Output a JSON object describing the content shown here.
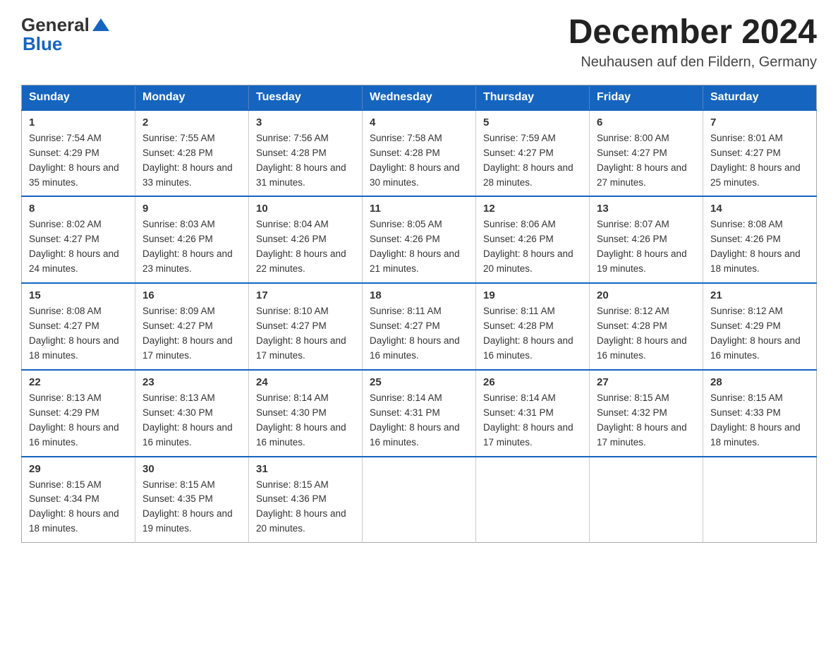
{
  "header": {
    "logo_general": "General",
    "logo_blue": "Blue",
    "month_title": "December 2024",
    "location": "Neuhausen auf den Fildern, Germany"
  },
  "columns": [
    "Sunday",
    "Monday",
    "Tuesday",
    "Wednesday",
    "Thursday",
    "Friday",
    "Saturday"
  ],
  "weeks": [
    [
      {
        "day": "1",
        "sunrise": "7:54 AM",
        "sunset": "4:29 PM",
        "daylight": "8 hours and 35 minutes."
      },
      {
        "day": "2",
        "sunrise": "7:55 AM",
        "sunset": "4:28 PM",
        "daylight": "8 hours and 33 minutes."
      },
      {
        "day": "3",
        "sunrise": "7:56 AM",
        "sunset": "4:28 PM",
        "daylight": "8 hours and 31 minutes."
      },
      {
        "day": "4",
        "sunrise": "7:58 AM",
        "sunset": "4:28 PM",
        "daylight": "8 hours and 30 minutes."
      },
      {
        "day": "5",
        "sunrise": "7:59 AM",
        "sunset": "4:27 PM",
        "daylight": "8 hours and 28 minutes."
      },
      {
        "day": "6",
        "sunrise": "8:00 AM",
        "sunset": "4:27 PM",
        "daylight": "8 hours and 27 minutes."
      },
      {
        "day": "7",
        "sunrise": "8:01 AM",
        "sunset": "4:27 PM",
        "daylight": "8 hours and 25 minutes."
      }
    ],
    [
      {
        "day": "8",
        "sunrise": "8:02 AM",
        "sunset": "4:27 PM",
        "daylight": "8 hours and 24 minutes."
      },
      {
        "day": "9",
        "sunrise": "8:03 AM",
        "sunset": "4:26 PM",
        "daylight": "8 hours and 23 minutes."
      },
      {
        "day": "10",
        "sunrise": "8:04 AM",
        "sunset": "4:26 PM",
        "daylight": "8 hours and 22 minutes."
      },
      {
        "day": "11",
        "sunrise": "8:05 AM",
        "sunset": "4:26 PM",
        "daylight": "8 hours and 21 minutes."
      },
      {
        "day": "12",
        "sunrise": "8:06 AM",
        "sunset": "4:26 PM",
        "daylight": "8 hours and 20 minutes."
      },
      {
        "day": "13",
        "sunrise": "8:07 AM",
        "sunset": "4:26 PM",
        "daylight": "8 hours and 19 minutes."
      },
      {
        "day": "14",
        "sunrise": "8:08 AM",
        "sunset": "4:26 PM",
        "daylight": "8 hours and 18 minutes."
      }
    ],
    [
      {
        "day": "15",
        "sunrise": "8:08 AM",
        "sunset": "4:27 PM",
        "daylight": "8 hours and 18 minutes."
      },
      {
        "day": "16",
        "sunrise": "8:09 AM",
        "sunset": "4:27 PM",
        "daylight": "8 hours and 17 minutes."
      },
      {
        "day": "17",
        "sunrise": "8:10 AM",
        "sunset": "4:27 PM",
        "daylight": "8 hours and 17 minutes."
      },
      {
        "day": "18",
        "sunrise": "8:11 AM",
        "sunset": "4:27 PM",
        "daylight": "8 hours and 16 minutes."
      },
      {
        "day": "19",
        "sunrise": "8:11 AM",
        "sunset": "4:28 PM",
        "daylight": "8 hours and 16 minutes."
      },
      {
        "day": "20",
        "sunrise": "8:12 AM",
        "sunset": "4:28 PM",
        "daylight": "8 hours and 16 minutes."
      },
      {
        "day": "21",
        "sunrise": "8:12 AM",
        "sunset": "4:29 PM",
        "daylight": "8 hours and 16 minutes."
      }
    ],
    [
      {
        "day": "22",
        "sunrise": "8:13 AM",
        "sunset": "4:29 PM",
        "daylight": "8 hours and 16 minutes."
      },
      {
        "day": "23",
        "sunrise": "8:13 AM",
        "sunset": "4:30 PM",
        "daylight": "8 hours and 16 minutes."
      },
      {
        "day": "24",
        "sunrise": "8:14 AM",
        "sunset": "4:30 PM",
        "daylight": "8 hours and 16 minutes."
      },
      {
        "day": "25",
        "sunrise": "8:14 AM",
        "sunset": "4:31 PM",
        "daylight": "8 hours and 16 minutes."
      },
      {
        "day": "26",
        "sunrise": "8:14 AM",
        "sunset": "4:31 PM",
        "daylight": "8 hours and 17 minutes."
      },
      {
        "day": "27",
        "sunrise": "8:15 AM",
        "sunset": "4:32 PM",
        "daylight": "8 hours and 17 minutes."
      },
      {
        "day": "28",
        "sunrise": "8:15 AM",
        "sunset": "4:33 PM",
        "daylight": "8 hours and 18 minutes."
      }
    ],
    [
      {
        "day": "29",
        "sunrise": "8:15 AM",
        "sunset": "4:34 PM",
        "daylight": "8 hours and 18 minutes."
      },
      {
        "day": "30",
        "sunrise": "8:15 AM",
        "sunset": "4:35 PM",
        "daylight": "8 hours and 19 minutes."
      },
      {
        "day": "31",
        "sunrise": "8:15 AM",
        "sunset": "4:36 PM",
        "daylight": "8 hours and 20 minutes."
      },
      {
        "day": "",
        "sunrise": "",
        "sunset": "",
        "daylight": ""
      },
      {
        "day": "",
        "sunrise": "",
        "sunset": "",
        "daylight": ""
      },
      {
        "day": "",
        "sunrise": "",
        "sunset": "",
        "daylight": ""
      },
      {
        "day": "",
        "sunrise": "",
        "sunset": "",
        "daylight": ""
      }
    ]
  ]
}
